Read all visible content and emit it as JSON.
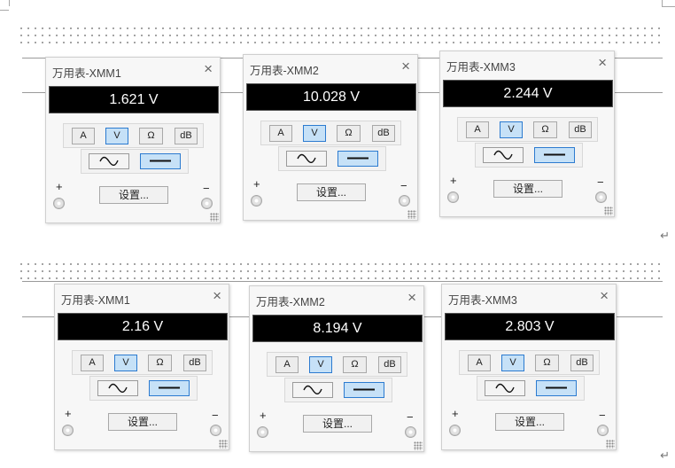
{
  "paragraph_mark": "↵",
  "meters": [
    {
      "title": "万用表-XMM1",
      "close": "×",
      "reading": "1.621 V",
      "modes": [
        "A",
        "V",
        "Ω",
        "dB"
      ],
      "selected_mode": "V",
      "selected_type": "dc",
      "settings": "设置...",
      "plus": "+",
      "minus": "−"
    },
    {
      "title": "万用表-XMM2",
      "close": "×",
      "reading": "10.028 V",
      "modes": [
        "A",
        "V",
        "Ω",
        "dB"
      ],
      "selected_mode": "V",
      "selected_type": "dc",
      "settings": "设置...",
      "plus": "+",
      "minus": "−"
    },
    {
      "title": "万用表-XMM3",
      "close": "×",
      "reading": "2.244 V",
      "modes": [
        "A",
        "V",
        "Ω",
        "dB"
      ],
      "selected_mode": "V",
      "selected_type": "dc",
      "settings": "设置...",
      "plus": "+",
      "minus": "−"
    },
    {
      "title": "万用表-XMM1",
      "close": "×",
      "reading": "2.16 V",
      "modes": [
        "A",
        "V",
        "Ω",
        "dB"
      ],
      "selected_mode": "V",
      "selected_type": "dc",
      "settings": "设置...",
      "plus": "+",
      "minus": "−"
    },
    {
      "title": "万用表-XMM2",
      "close": "×",
      "reading": "8.194 V",
      "modes": [
        "A",
        "V",
        "Ω",
        "dB"
      ],
      "selected_mode": "V",
      "selected_type": "dc",
      "settings": "设置...",
      "plus": "+",
      "minus": "−"
    },
    {
      "title": "万用表-XMM3",
      "close": "×",
      "reading": "2.803 V",
      "modes": [
        "A",
        "V",
        "Ω",
        "dB"
      ],
      "selected_mode": "V",
      "selected_type": "dc",
      "settings": "设置...",
      "plus": "+",
      "minus": "−"
    }
  ]
}
